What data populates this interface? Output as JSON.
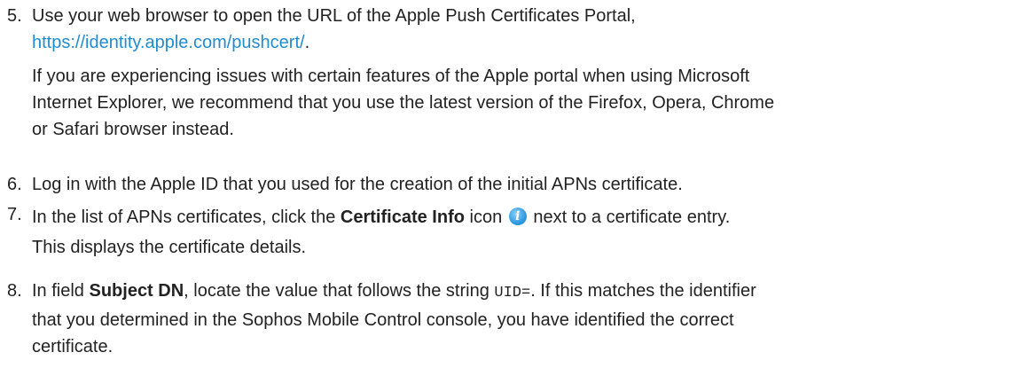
{
  "steps": [
    {
      "number": "5.",
      "line1": "Use your web browser to open the URL of the Apple Push Certificates Portal,",
      "link": "https://identity.apple.com/pushcert/",
      "link_suffix": ".",
      "note_line1": "If you are experiencing issues with certain features of the Apple portal when using Microsoft",
      "note_line2": "Internet Explorer, we recommend that you use the latest version of the Firefox, Opera, Chrome",
      "note_line3": "or Safari browser instead."
    },
    {
      "number": "6.",
      "text": "Log in with the Apple ID that you used for the creation of the initial APNs certificate."
    },
    {
      "number": "7.",
      "text_before": "In the list of APNs certificates, click the ",
      "bold": "Certificate Info",
      "text_mid": " icon ",
      "text_after": " next to a certificate entry.",
      "result": "This displays the certificate details.",
      "icon": "info-icon"
    },
    {
      "number": "8.",
      "text_before": "In field ",
      "bold": "Subject DN",
      "text_mid": ", locate the value that follows the string ",
      "code": "UID=",
      "text_after": ". If this matches the identifier",
      "line2": "that you determined in the Sophos Mobile Control console, you have identified the correct",
      "line3": "certificate."
    }
  ],
  "colors": {
    "link": "#1f8ccf",
    "text": "#222222",
    "icon": "#2f9be0"
  }
}
